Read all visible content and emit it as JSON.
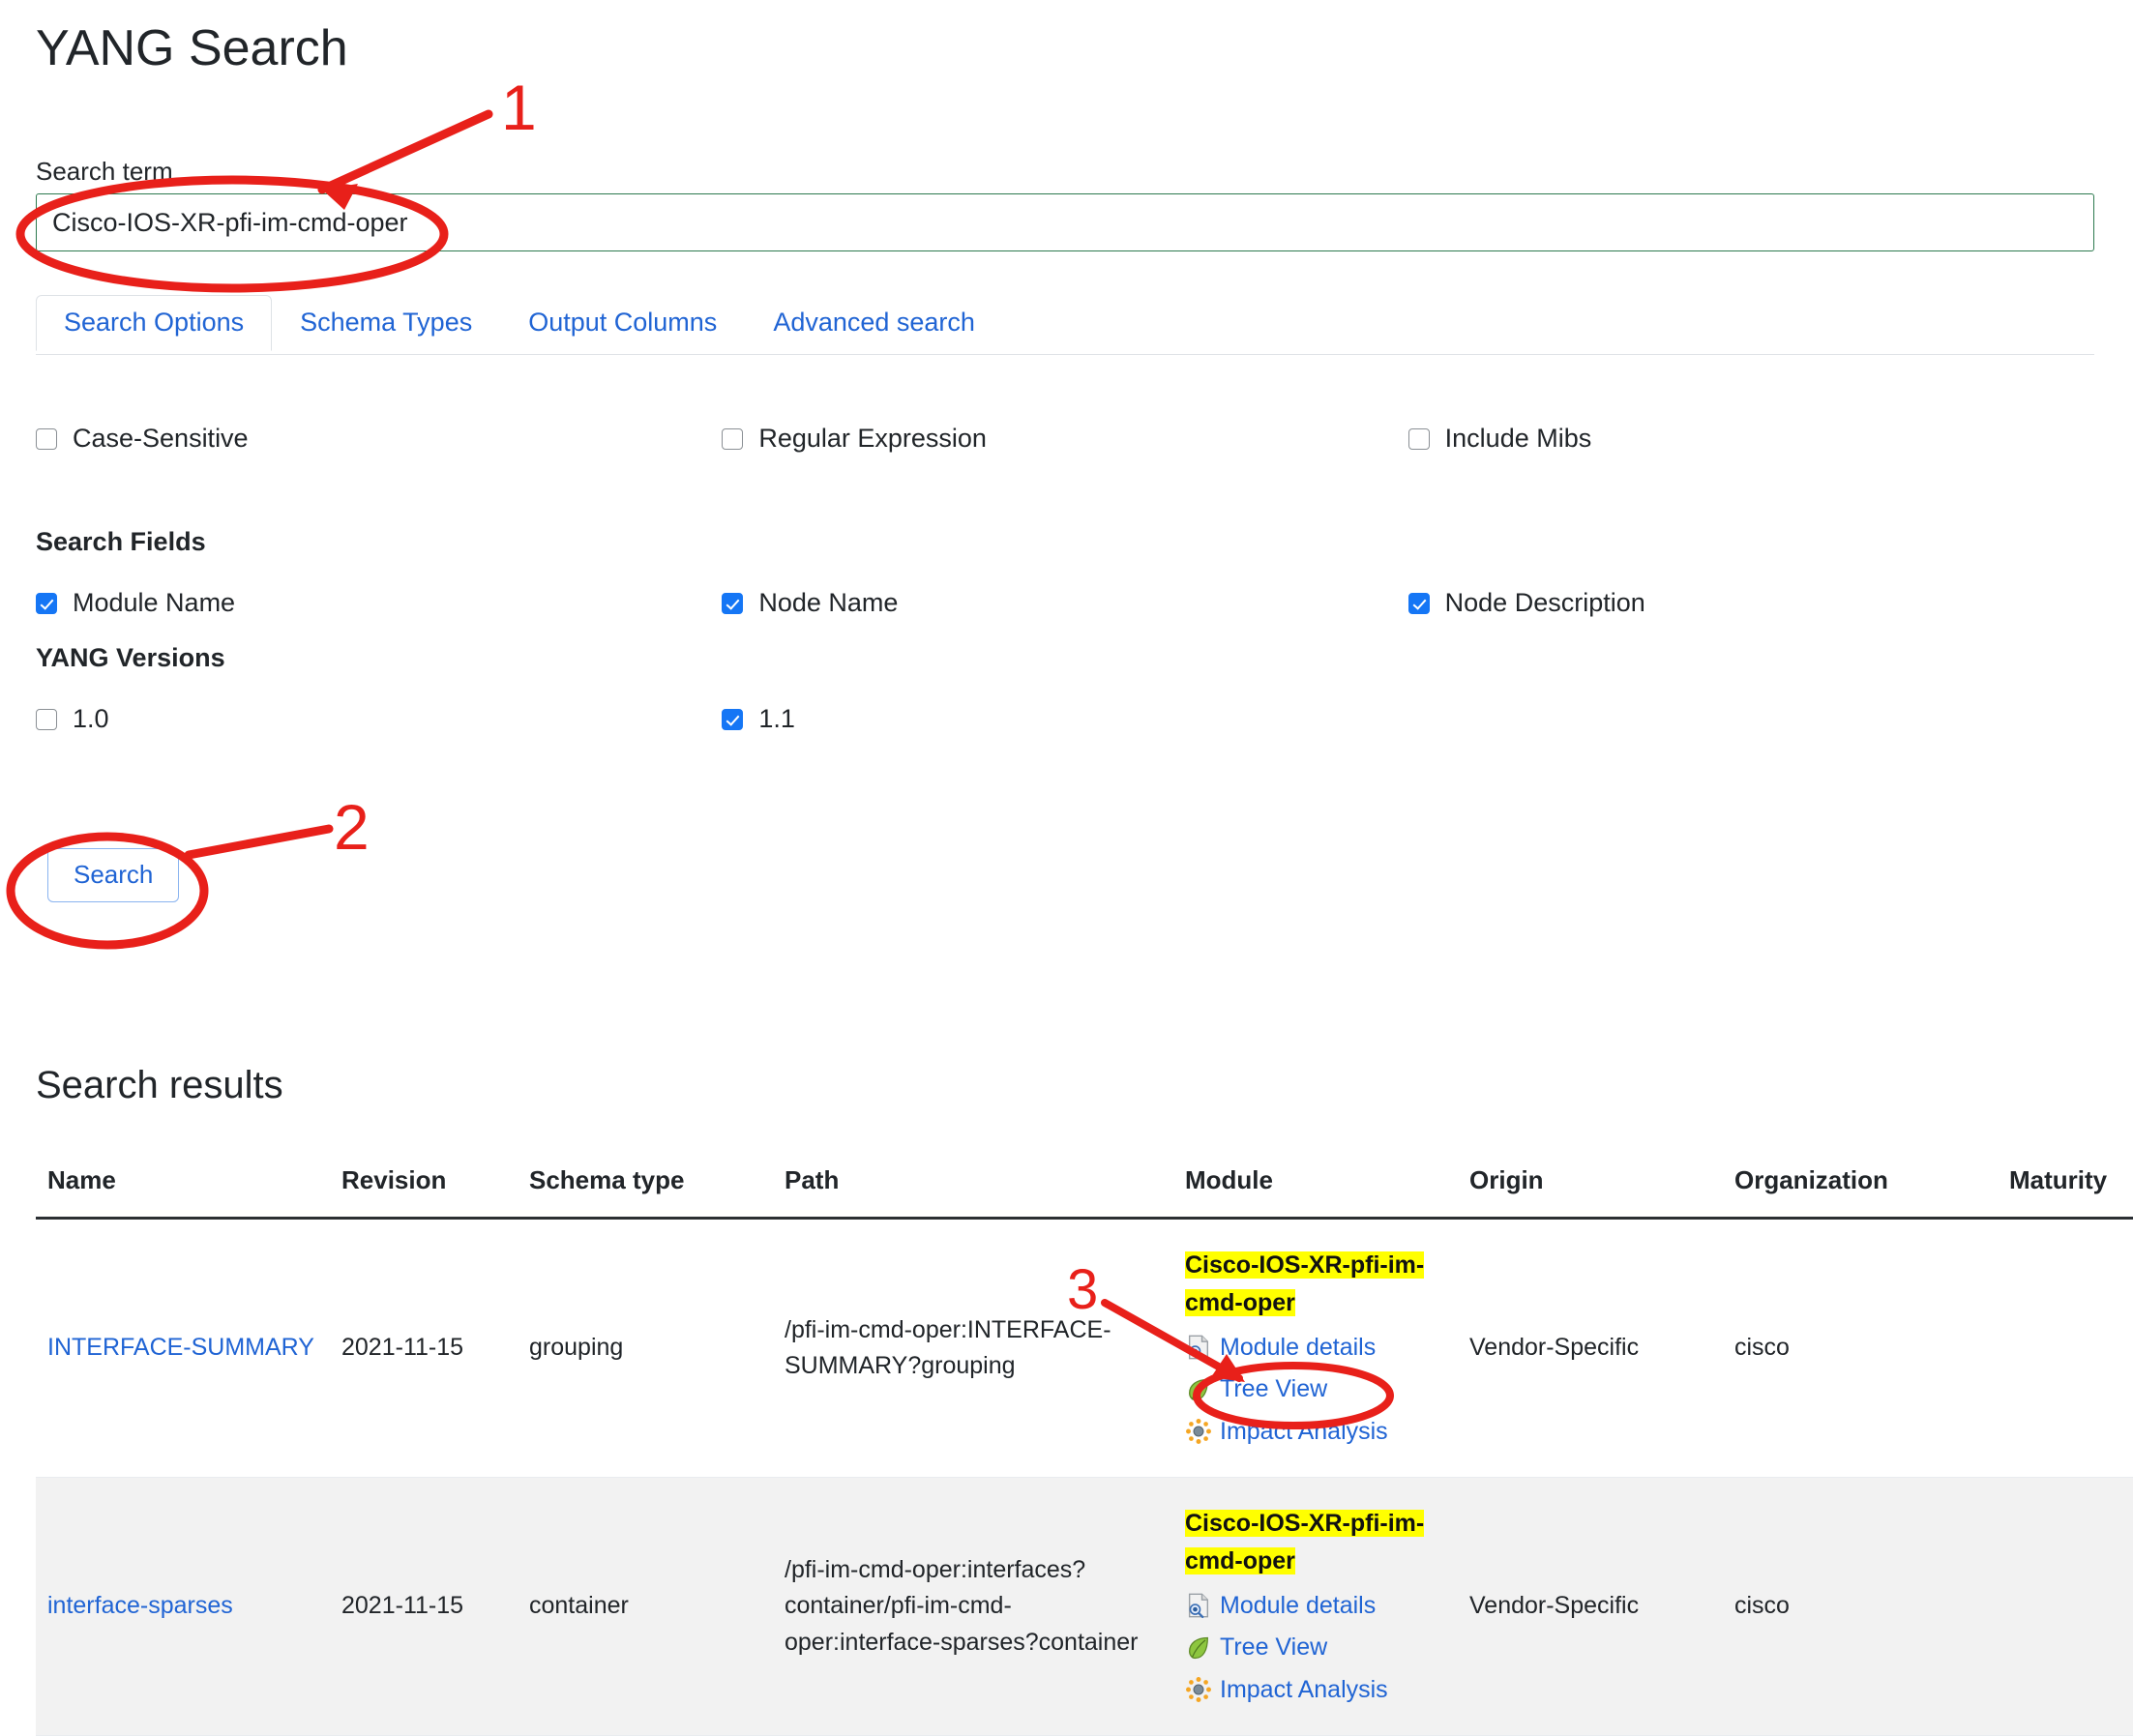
{
  "page": {
    "title": "YANG Search"
  },
  "search": {
    "label": "Search term",
    "value": "Cisco-IOS-XR-pfi-im-cmd-oper",
    "placeholder": "",
    "button_label": "Search",
    "border_color": "#2d7a4f"
  },
  "tabs": [
    {
      "label": "Search Options",
      "active": true
    },
    {
      "label": "Schema Types",
      "active": false
    },
    {
      "label": "Output Columns",
      "active": false
    },
    {
      "label": "Advanced search",
      "active": false
    }
  ],
  "options": {
    "toggles": [
      {
        "label": "Case-Sensitive",
        "checked": false
      },
      {
        "label": "Regular Expression",
        "checked": false
      },
      {
        "label": "Include Mibs",
        "checked": false
      }
    ],
    "search_fields_heading": "Search Fields",
    "search_fields": [
      {
        "label": "Module Name",
        "checked": true
      },
      {
        "label": "Node Name",
        "checked": true
      },
      {
        "label": "Node Description",
        "checked": true
      }
    ],
    "yang_versions_heading": "YANG Versions",
    "yang_versions": [
      {
        "label": "1.0",
        "checked": false
      },
      {
        "label": "1.1",
        "checked": true
      }
    ]
  },
  "results": {
    "heading": "Search results",
    "columns": [
      "Name",
      "Revision",
      "Schema type",
      "Path",
      "Module",
      "Origin",
      "Organization",
      "Maturity"
    ],
    "rows": [
      {
        "name": "INTERFACE-SUMMARY",
        "revision": "2021-11-15",
        "schema_type": "grouping",
        "path": "/pfi-im-cmd-oper:INTERFACE-SUMMARY?grouping",
        "module": "Cisco-IOS-XR-pfi-im-cmd-oper",
        "module_links": [
          "Module details",
          "Tree View",
          "Impact Analysis"
        ],
        "origin": "Vendor-Specific",
        "organization": "cisco",
        "maturity": ""
      },
      {
        "name": "interface-sparses",
        "revision": "2021-11-15",
        "schema_type": "container",
        "path": "/pfi-im-cmd-oper:interfaces?container/pfi-im-cmd-oper:interface-sparses?container",
        "module": "Cisco-IOS-XR-pfi-im-cmd-oper",
        "module_links": [
          "Module details",
          "Tree View",
          "Impact Analysis"
        ],
        "origin": "Vendor-Specific",
        "organization": "cisco",
        "maturity": ""
      }
    ],
    "highlight_color": "#ffff00"
  },
  "annotations": {
    "color": "#e8201a",
    "markers": [
      {
        "number": "1",
        "target": "search-input"
      },
      {
        "number": "2",
        "target": "search-button"
      },
      {
        "number": "3",
        "target": "tree-view-link"
      }
    ]
  }
}
